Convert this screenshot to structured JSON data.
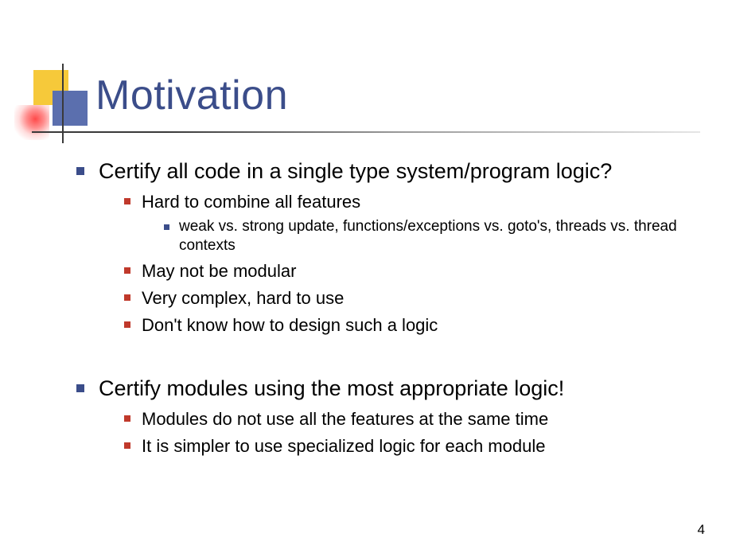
{
  "title": "Motivation",
  "page_number": "4",
  "bullets": {
    "l1_0": "Certify all code in a single type system/program logic?",
    "l2_0": "Hard to combine all features",
    "l3_0": "weak vs. strong update, functions/exceptions vs. goto's, threads vs. thread contexts",
    "l2_1": "May not be modular",
    "l2_2": "Very complex, hard to use",
    "l2_3": "Don't know how to design such a logic",
    "l1_1": "Certify modules using the most appropriate logic!",
    "l2_4": "Modules do not use all the features at the same time",
    "l2_5": "It is simpler to use specialized logic for each module"
  }
}
